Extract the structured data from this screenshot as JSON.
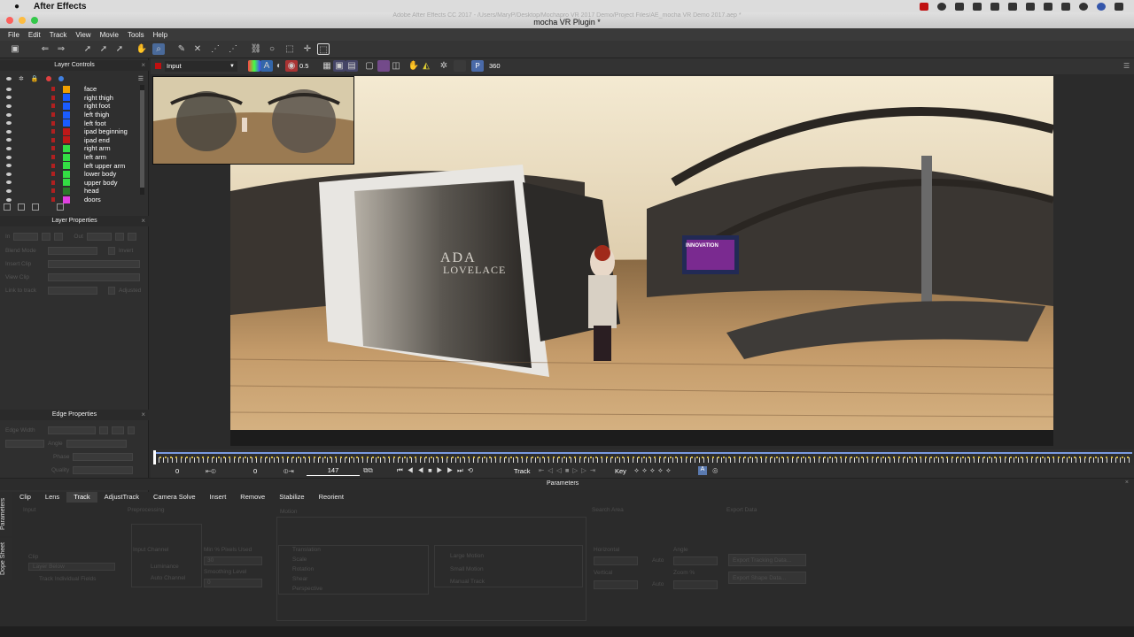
{
  "mac_menubar": {
    "app_name": "After Effects"
  },
  "window": {
    "path_title": "Adobe After Effects CC 2017 - /Users/MaryP/Desktop/Mochapro VR 2017 Demo/Project Files/AE_mocha VR Demo 2017.aep *",
    "title": "mocha VR Plugin *"
  },
  "menu": [
    "File",
    "Edit",
    "Track",
    "View",
    "Movie",
    "Tools",
    "Help"
  ],
  "layer_controls": {
    "title": "Layer Controls",
    "layers": [
      {
        "name": "face",
        "color": "#f0a000"
      },
      {
        "name": "right thigh",
        "color": "#1a5cff"
      },
      {
        "name": "right foot",
        "color": "#1a5cff"
      },
      {
        "name": "left thigh",
        "color": "#1a5cff"
      },
      {
        "name": "left foot",
        "color": "#1a5cff"
      },
      {
        "name": "ipad beginning",
        "color": "#c01818"
      },
      {
        "name": "ipad end",
        "color": "#c01818"
      },
      {
        "name": "right arm",
        "color": "#33dd44"
      },
      {
        "name": "left arm",
        "color": "#33dd44"
      },
      {
        "name": "left upper arm",
        "color": "#33dd44"
      },
      {
        "name": "lower body",
        "color": "#33dd44"
      },
      {
        "name": "upper body",
        "color": "#33dd44"
      },
      {
        "name": "head",
        "color": "#2a7a2a"
      },
      {
        "name": "doors",
        "color": "#e040e0"
      }
    ]
  },
  "layer_properties": {
    "title": "Layer Properties",
    "in_label": "In",
    "out_label": "Out",
    "blend_mode": "Blend Mode",
    "insert_clip": "Insert Clip",
    "view_clip": "View Clip",
    "link_to_track": "Link to track",
    "invert": "Invert",
    "adjusted": "Adjusted"
  },
  "edge_properties": {
    "title": "Edge Properties",
    "edge_width": "Edge Width",
    "angle": "Angle",
    "phase": "Phase",
    "quality": "Quality"
  },
  "view_toolbar": {
    "input_label": "Input",
    "opacity": "0.5",
    "p_label": "P",
    "vr_label": "360"
  },
  "transport": {
    "start_frame": "0",
    "in_frame": "0",
    "current_frame": "147",
    "track_label": "Track",
    "key_label": "Key"
  },
  "parameters": {
    "title": "Parameters",
    "tabs": [
      "Clip",
      "Lens",
      "Track",
      "AdjustTrack",
      "Camera Solve",
      "Insert",
      "Remove",
      "Stabilize",
      "Reorient"
    ],
    "active_tab": "Track",
    "side_tabs": [
      "Parameters",
      "Dope Sheet"
    ],
    "sections": {
      "input": "Input",
      "preprocessing": "Preprocessing",
      "motion": "Motion",
      "search_area": "Search Area",
      "export_data": "Export Data"
    },
    "clip_label": "Clip",
    "clip_value": "Layer Below",
    "track_individual": "Track Individual Fields",
    "input_channel": "Input Channel",
    "luminance": "Luminance",
    "auto_channel": "Auto Channel",
    "min_pixels": "Min % Pixels Used",
    "min_pixels_value": "30",
    "smoothing": "Smoothing Level",
    "smoothing_value": "0",
    "motion_options": [
      "Translation",
      "Scale",
      "Rotation",
      "Shear",
      "Perspective"
    ],
    "motion_types": [
      "Large Motion",
      "Small Motion",
      "Manual Track"
    ],
    "horizontal": "Horizontal",
    "vertical": "Vertical",
    "auto": "Auto",
    "angle": "Angle",
    "zoom": "Zoom %",
    "export_tracking": "Export Tracking Data...",
    "export_shape": "Export Shape Data..."
  },
  "scene_text": {
    "sign1": "ADA",
    "sign2": "LOVELACE",
    "sign3": "INNOVATION"
  }
}
